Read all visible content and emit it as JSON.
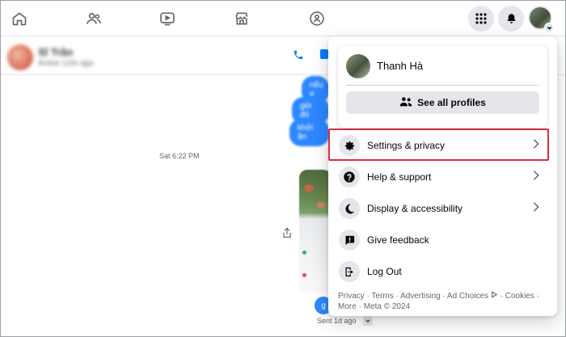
{
  "nav": {
    "icons": [
      "home-icon",
      "friends-icon",
      "watch-icon",
      "marketplace-icon",
      "groups-icon"
    ],
    "right_icons": [
      "menu-grid-icon",
      "bell-icon"
    ]
  },
  "chat": {
    "contact_name": "Sĩ Trần",
    "contact_status": "Active 12m ago",
    "bubbles": [
      "nếu e",
      "giờ đó",
      "khởi ăn"
    ],
    "timestamp": "Sat 6:22 PM",
    "last_bubble": "g",
    "sent_label": "Sent 1d ago"
  },
  "menu": {
    "profile_name": "Thanh Hà",
    "see_all_profiles": "See all profiles",
    "items": [
      {
        "label": "Settings & privacy",
        "icon": "gear-icon",
        "has_chevron": true
      },
      {
        "label": "Help & support",
        "icon": "question-icon",
        "has_chevron": true
      },
      {
        "label": "Display & accessibility",
        "icon": "moon-icon",
        "has_chevron": true
      },
      {
        "label": "Give feedback",
        "icon": "feedback-icon",
        "has_chevron": false
      },
      {
        "label": "Log Out",
        "icon": "logout-icon",
        "has_chevron": false
      }
    ],
    "footer": {
      "privacy": "Privacy",
      "terms": "Terms",
      "advertising": "Advertising",
      "ad_choices": "Ad Choices",
      "cookies": "Cookies",
      "more": "More",
      "copyright": "Meta © 2024"
    }
  },
  "colors": {
    "accent": "#2d88ff",
    "highlight_border": "#d32f45",
    "icon_bg": "#e4e6eb"
  }
}
